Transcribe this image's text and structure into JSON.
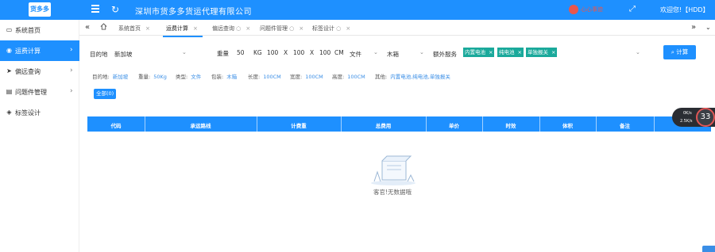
{
  "header": {
    "logo_text": "货多多",
    "company": "深圳市货多多货运代理有限公司",
    "badge_text": "心心事迹",
    "welcome": "欢迎您!【HDD】"
  },
  "sidebar": {
    "items": [
      {
        "label": "系统首页",
        "icon": "desktop-icon"
      },
      {
        "label": "运费计算",
        "icon": "location-pin-icon",
        "active": true
      },
      {
        "label": "偏远查询",
        "icon": "send-icon"
      },
      {
        "label": "问题件管理",
        "icon": "document-icon"
      },
      {
        "label": "标签设计",
        "icon": "tag-icon"
      }
    ]
  },
  "tabs": [
    {
      "label": "系统首页",
      "suffix": ""
    },
    {
      "label": "运费计算",
      "suffix": "",
      "active": true
    },
    {
      "label": "偏远查询",
      "suffix": "◌"
    },
    {
      "label": "问题件管理",
      "suffix": "◌"
    },
    {
      "label": "标签设计",
      "suffix": "◌"
    }
  ],
  "form": {
    "destination_label": "目的地",
    "destination_value": "新加坡",
    "weight_label": "重量",
    "weight_value": "50",
    "weight_unit": "KG",
    "length": "100",
    "width": "100",
    "height": "100",
    "x_sep": "X",
    "size_unit": "CM",
    "type_value": "文件",
    "package_value": "木箱",
    "extra_label": "额外服务",
    "tags": [
      "内置电池",
      "纯电池",
      "单独报关"
    ],
    "calc_button": "计算"
  },
  "summary": [
    {
      "k": "目的地:",
      "v": "新加坡"
    },
    {
      "k": "重量:",
      "v": "50Kg"
    },
    {
      "k": "类型:",
      "v": "文件"
    },
    {
      "k": "包装:",
      "v": "木箱"
    },
    {
      "k": "长度:",
      "v": "100CM"
    },
    {
      "k": "宽度:",
      "v": "100CM"
    },
    {
      "k": "高度:",
      "v": "100CM"
    },
    {
      "k": "其他:",
      "v": "内置电池,纯电池,单独报关"
    }
  ],
  "filter": {
    "all_button": "全部(0)"
  },
  "table": {
    "columns": [
      "代码",
      "承运路线",
      "计费重",
      "总费用",
      "单价",
      "时效",
      "体积",
      "备注"
    ]
  },
  "empty": {
    "text": "客官!无数据哦"
  },
  "speed": {
    "up": "0K/s",
    "down": "2.5K/s",
    "value": "33"
  },
  "colors": {
    "primary": "#1e90ff",
    "tag": "#1aa99b"
  }
}
